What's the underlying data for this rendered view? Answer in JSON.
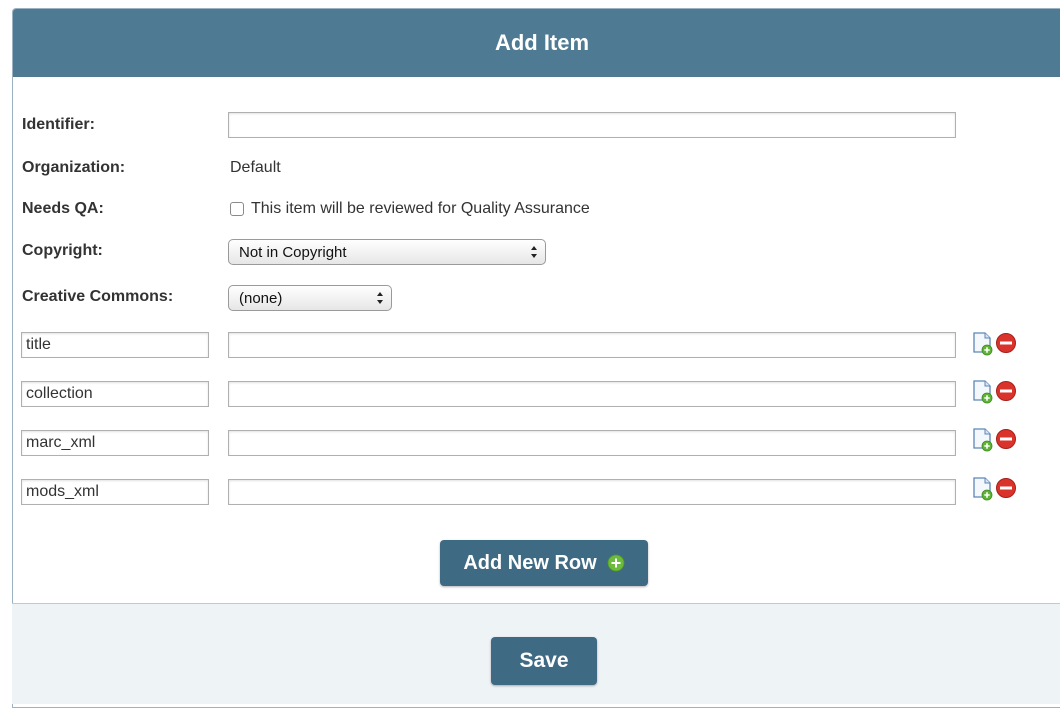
{
  "header": {
    "title": "Add Item"
  },
  "form": {
    "identifier_label": "Identifier:",
    "identifier_value": "",
    "organization_label": "Organization:",
    "organization_value": "Default",
    "needs_qa_label": "Needs QA:",
    "needs_qa_text": "This item will be reviewed for Quality Assurance",
    "needs_qa_checked": false,
    "copyright_label": "Copyright:",
    "copyright_value": "Not in Copyright",
    "cc_label": "Creative Commons:",
    "cc_value": "(none)"
  },
  "rows": [
    {
      "key": "title",
      "value": ""
    },
    {
      "key": "collection",
      "value": ""
    },
    {
      "key": "marc_xml",
      "value": ""
    },
    {
      "key": "mods_xml",
      "value": ""
    }
  ],
  "buttons": {
    "add_row_label": "Add New Row",
    "save_label": "Save"
  },
  "icons": {
    "add_row_icon": "add-document-icon",
    "remove_row_icon": "remove-circle-icon",
    "plus_icon": "plus-circle-icon"
  },
  "colors": {
    "header_bg": "#4f7a94",
    "button_bg": "#3f6a84",
    "remove_red": "#d9332c",
    "add_green": "#6dbb3c"
  }
}
